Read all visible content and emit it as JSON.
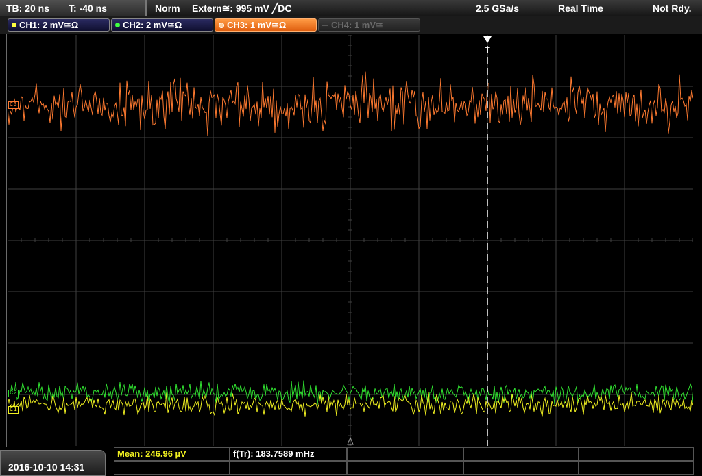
{
  "topbar": {
    "timebase": "TB: 20 ns",
    "trigger_offset": "T: -40 ns",
    "trigger_mode": "Norm",
    "trigger_source": "Extern≅: 995 mV ╱DC",
    "sample_rate": "2.5 GSa/s",
    "acq_mode": "Real Time",
    "status": "Not Rdy."
  },
  "channels": [
    {
      "label": "CH1: 2 mV≅Ω",
      "color": "#ffff40",
      "state": "on"
    },
    {
      "label": "CH2: 2 mV≅Ω",
      "color": "#40ff40",
      "state": "on"
    },
    {
      "label": "CH3: 1 mV≅Ω",
      "color": "#ff8c3c",
      "state": "active"
    },
    {
      "label": "CH4: 1 mV≅",
      "color": "#6a6a6a",
      "state": "off"
    }
  ],
  "markers": {
    "ch3": "C3",
    "ch2": "C2",
    "ch1": "C1",
    "trigger": "T"
  },
  "colors": {
    "ch1": "#f0f020",
    "ch2": "#30e030",
    "ch3": "#ff7a30",
    "grid": "#404040"
  },
  "measurements": {
    "mean": "Mean: 246.96 µV",
    "freq": "f(Tr): 183.7589 mHz"
  },
  "datetime": "2016-10-10 14:31"
}
